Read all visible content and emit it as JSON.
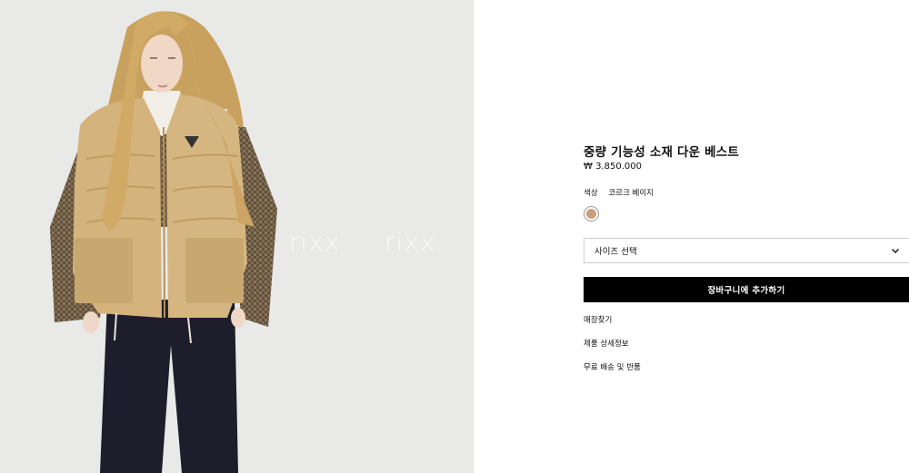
{
  "product": {
    "title": "중량 기능성 소재 다운 베스트",
    "price": "₩ 3.850.000"
  },
  "color": {
    "label": "색상",
    "value": "코르크 베이지",
    "swatch_hex": "#c9a07c"
  },
  "size_select": {
    "label": "사이즈 선택",
    "icon": "chevron-down-icon"
  },
  "cart_button": {
    "label": "장바구니에 추가하기"
  },
  "links": [
    {
      "label": "매장찾기"
    },
    {
      "label": "제품 상세정보"
    },
    {
      "label": "무료 배송 및 반품"
    }
  ],
  "image": {
    "watermark": "rixx"
  },
  "colors": {
    "image_bg": "#e9e9e8",
    "vest": "#d4b37c",
    "button_bg": "#000000"
  }
}
